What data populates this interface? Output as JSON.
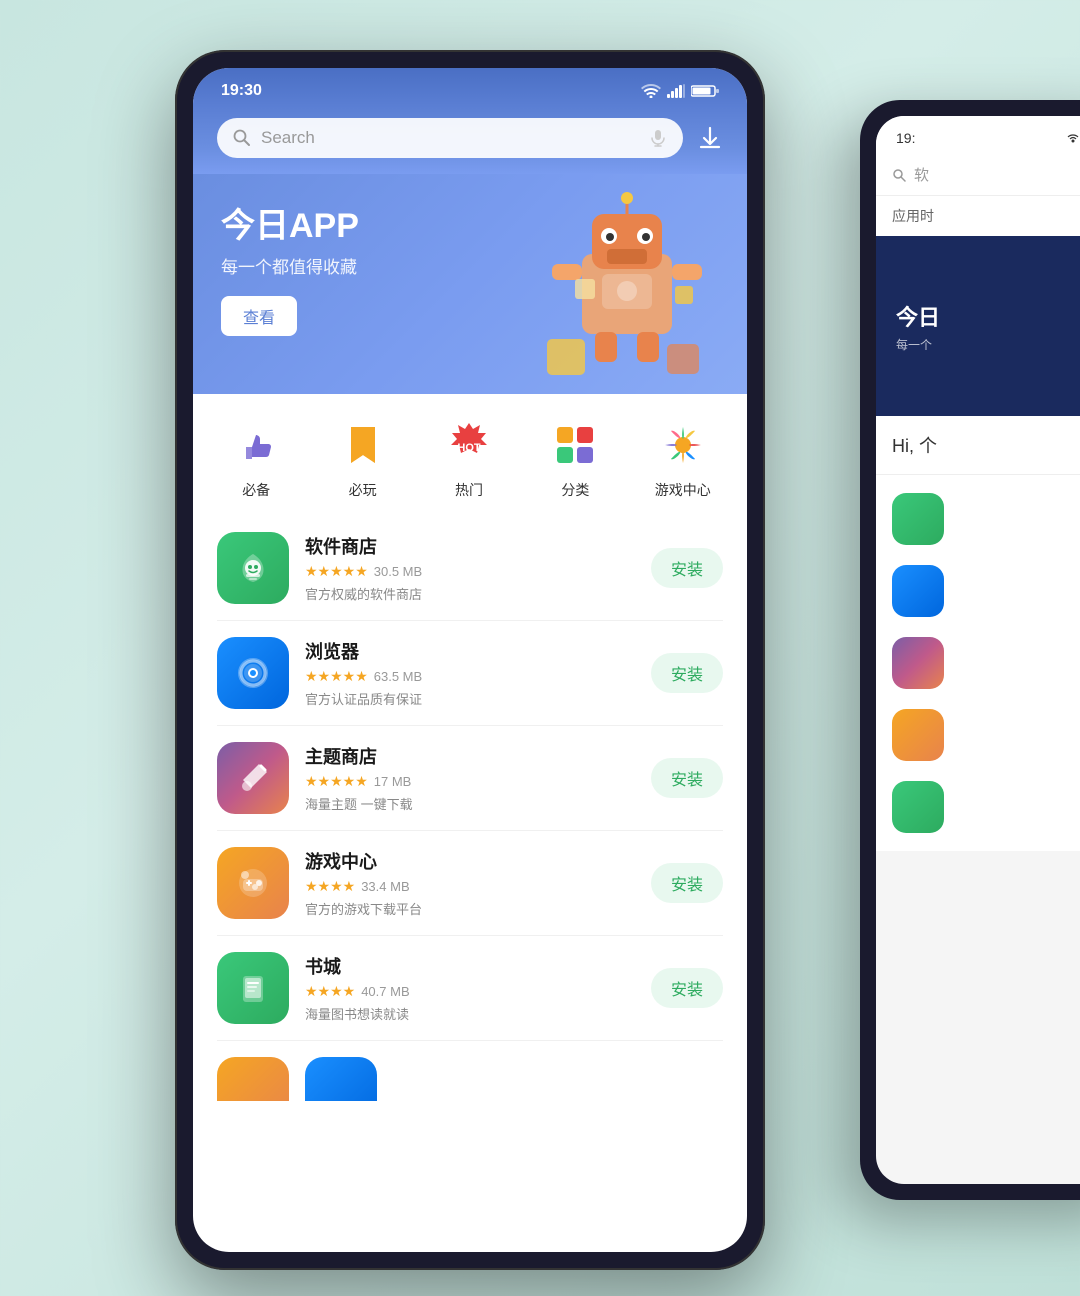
{
  "background": "#c8e6e0",
  "phone1": {
    "status": {
      "time": "19:30",
      "wifi": "wifi",
      "signal": "signal",
      "battery": "battery"
    },
    "search": {
      "placeholder": "Search",
      "mic_icon": "mic",
      "download_icon": "download"
    },
    "banner": {
      "title": "今日APP",
      "subtitle": "每一个都值得收藏",
      "button_label": "查看"
    },
    "categories": [
      {
        "id": "essential",
        "icon": "👍",
        "label": "必备"
      },
      {
        "id": "play",
        "icon": "🔖",
        "label": "必玩"
      },
      {
        "id": "hot",
        "icon": "🔥",
        "label": "热门"
      },
      {
        "id": "category",
        "icon": "⊞",
        "label": "分类"
      },
      {
        "id": "games",
        "icon": "✦",
        "label": "游戏中心"
      }
    ],
    "apps": [
      {
        "id": "software-store",
        "name": "软件商店",
        "rating": "★★★★★",
        "size": "30.5 MB",
        "desc": "官方权威的软件商店",
        "install": "安装",
        "icon_bg": "#3ac87a",
        "icon_type": "software"
      },
      {
        "id": "browser",
        "name": "浏览器",
        "rating": "★★★★★",
        "size": "63.5 MB",
        "desc": "官方认证品质有保证",
        "install": "安装",
        "icon_bg": "#1a8fff",
        "icon_type": "browser"
      },
      {
        "id": "theme-store",
        "name": "主题商店",
        "rating": "★★★★★",
        "size": "17 MB",
        "desc": "海量主题 一键下载",
        "install": "安装",
        "icon_bg": "#7b5ea7",
        "icon_type": "theme"
      },
      {
        "id": "game-center",
        "name": "游戏中心",
        "rating": "★★★★",
        "size": "33.4 MB",
        "desc": "官方的游戏下载平台",
        "install": "安装",
        "icon_bg": "#f5a623",
        "icon_type": "game"
      },
      {
        "id": "book-city",
        "name": "书城",
        "rating": "★★★★",
        "size": "40.7 MB",
        "desc": "海量图书想读就读",
        "install": "安装",
        "icon_bg": "#3ac87a",
        "icon_type": "book"
      }
    ]
  },
  "phone2": {
    "status": {
      "time": "19:",
      "search_placeholder": "软"
    },
    "section_label": "应用时",
    "banner": {
      "title": "今日",
      "subtitle": "每一个"
    },
    "greeting": "Hi, 个",
    "apps": [
      {
        "icon_type": "software",
        "icon_bg": "#3ac87a"
      },
      {
        "icon_type": "browser",
        "icon_bg": "#1a8fff"
      },
      {
        "icon_type": "theme",
        "icon_bg": "#7b5ea7"
      },
      {
        "icon_type": "game",
        "icon_bg": "#f5a623"
      },
      {
        "icon_type": "book",
        "icon_bg": "#3ac87a"
      }
    ]
  }
}
